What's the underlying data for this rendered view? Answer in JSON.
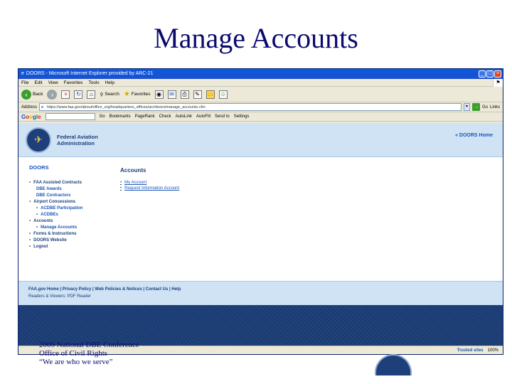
{
  "slide": {
    "title": "Manage Accounts",
    "footer_lines": [
      "2009 National DBE Conference",
      "Office of Civil Rights",
      "“We are who we serve”"
    ]
  },
  "browser": {
    "window_title": "DOORS - Microsoft Internet Explorer provided by ARC-21",
    "menu": [
      "File",
      "Edit",
      "View",
      "Favorites",
      "Tools",
      "Help"
    ],
    "toolbar": {
      "back": "Back",
      "search": "Search",
      "favorites": "Favorites"
    },
    "address": {
      "label": "Address",
      "value": "https://www.faa.gov/about/office_org/headquarters_offices/acr/doors/manage_accounts.cfm",
      "go": "Go",
      "links": "Links"
    },
    "google": {
      "search_value": "",
      "items": [
        "Go",
        "Bookmarks",
        "PageRank",
        "Check",
        "AutoLink",
        "AutoFill",
        "Send to",
        "Settings"
      ]
    },
    "status": {
      "zone": "Trusted sites",
      "zoom": "100%"
    }
  },
  "page": {
    "org_name_line1": "Federal Aviation",
    "org_name_line2": "Administration",
    "doors_home": "« DOORS Home",
    "nav_heading": "DOORS",
    "nav": [
      {
        "label": "FAA Assisted Contracts",
        "sub": [
          "DBE Awards",
          "DBE Contractors"
        ]
      },
      {
        "label": "Airport Concessions",
        "sub": [
          "ACDBE Participation",
          "ACDBEs"
        ]
      },
      {
        "label": "Accounts",
        "sub": [
          "Manage Accounts"
        ]
      },
      {
        "label": "Forms & Instructions",
        "sub": []
      },
      {
        "label": "DOORS Website",
        "sub": []
      },
      {
        "label": "Logout",
        "sub": []
      }
    ],
    "accounts_heading": "Accounts",
    "accounts_links": [
      "My Account",
      "Request Information Account"
    ],
    "footer_links": [
      "FAA.gov Home",
      "Privacy Policy",
      "Web Policies & Notices",
      "Contact Us",
      "Help"
    ],
    "footer_separator": " | ",
    "readers": "Readers & Viewers: PDF Reader"
  },
  "icons": {
    "window": "ie-icon",
    "back": "back-arrow-icon",
    "forward": "forward-arrow-icon",
    "stop": "stop-icon",
    "refresh": "refresh-icon",
    "home": "home-icon",
    "search": "search-icon",
    "favorites": "favorites-star-icon",
    "media": "media-icon",
    "mail": "mail-icon",
    "print": "print-icon",
    "edit": "edit-icon",
    "folder": "folder-icon",
    "messenger": "messenger-icon"
  }
}
